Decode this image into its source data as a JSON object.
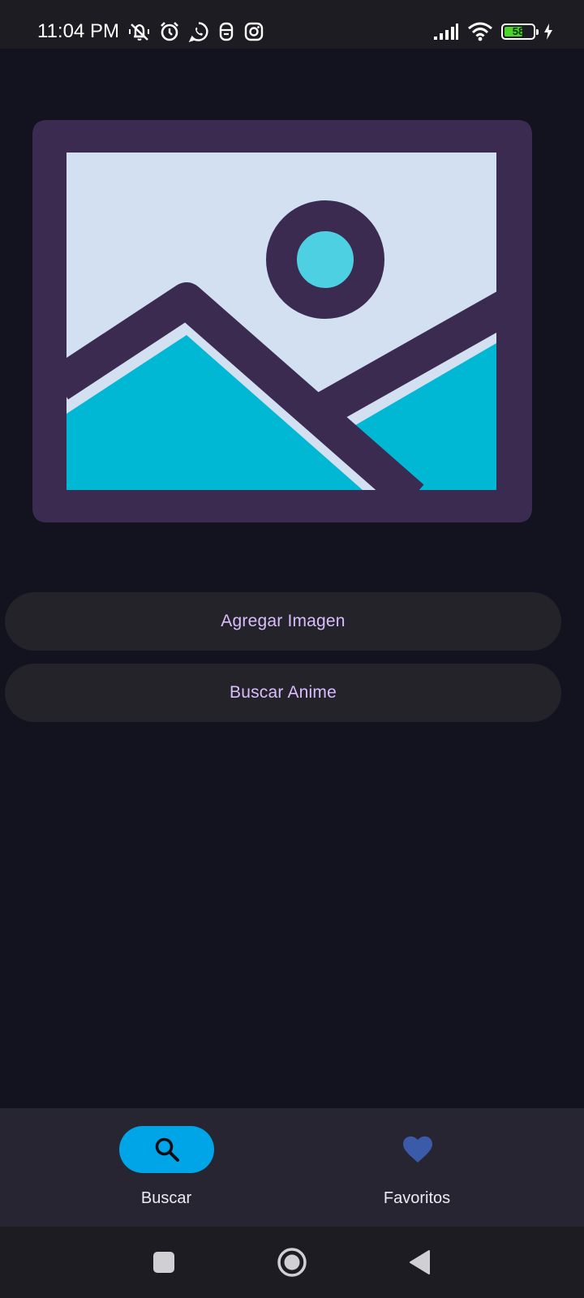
{
  "status_bar": {
    "time": "11:04 PM",
    "battery_level": "58",
    "icons_left": [
      "mute-vibrate-icon",
      "alarm-icon",
      "whatsapp-icon",
      "notification-app-icon",
      "instagram-icon"
    ],
    "icons_right": [
      "signal-icon",
      "wifi-icon",
      "battery-icon",
      "charging-icon"
    ]
  },
  "main": {
    "image_placeholder_icon": "image-placeholder-icon",
    "add_image_label": "Agregar Imagen",
    "search_anime_label": "Buscar Anime"
  },
  "bottom_nav": {
    "items": [
      {
        "label": "Buscar",
        "icon": "search-icon",
        "selected": true
      },
      {
        "label": "Favoritos",
        "icon": "heart-icon",
        "selected": false
      }
    ]
  },
  "system_nav": {
    "icons": [
      "recent-apps-icon",
      "home-icon",
      "back-icon"
    ]
  },
  "colors": {
    "background": "#131320",
    "button_bg": "#232329",
    "button_text": "#d9bdfc",
    "nav_bg": "#262531",
    "nav_active": "#00a5e8",
    "heart": "#3b5ba8",
    "placeholder_frame": "#3b2b50",
    "placeholder_sky": "#d3e0f2",
    "placeholder_hills": "#00b8d4",
    "placeholder_sun": "#4dd0e1"
  }
}
